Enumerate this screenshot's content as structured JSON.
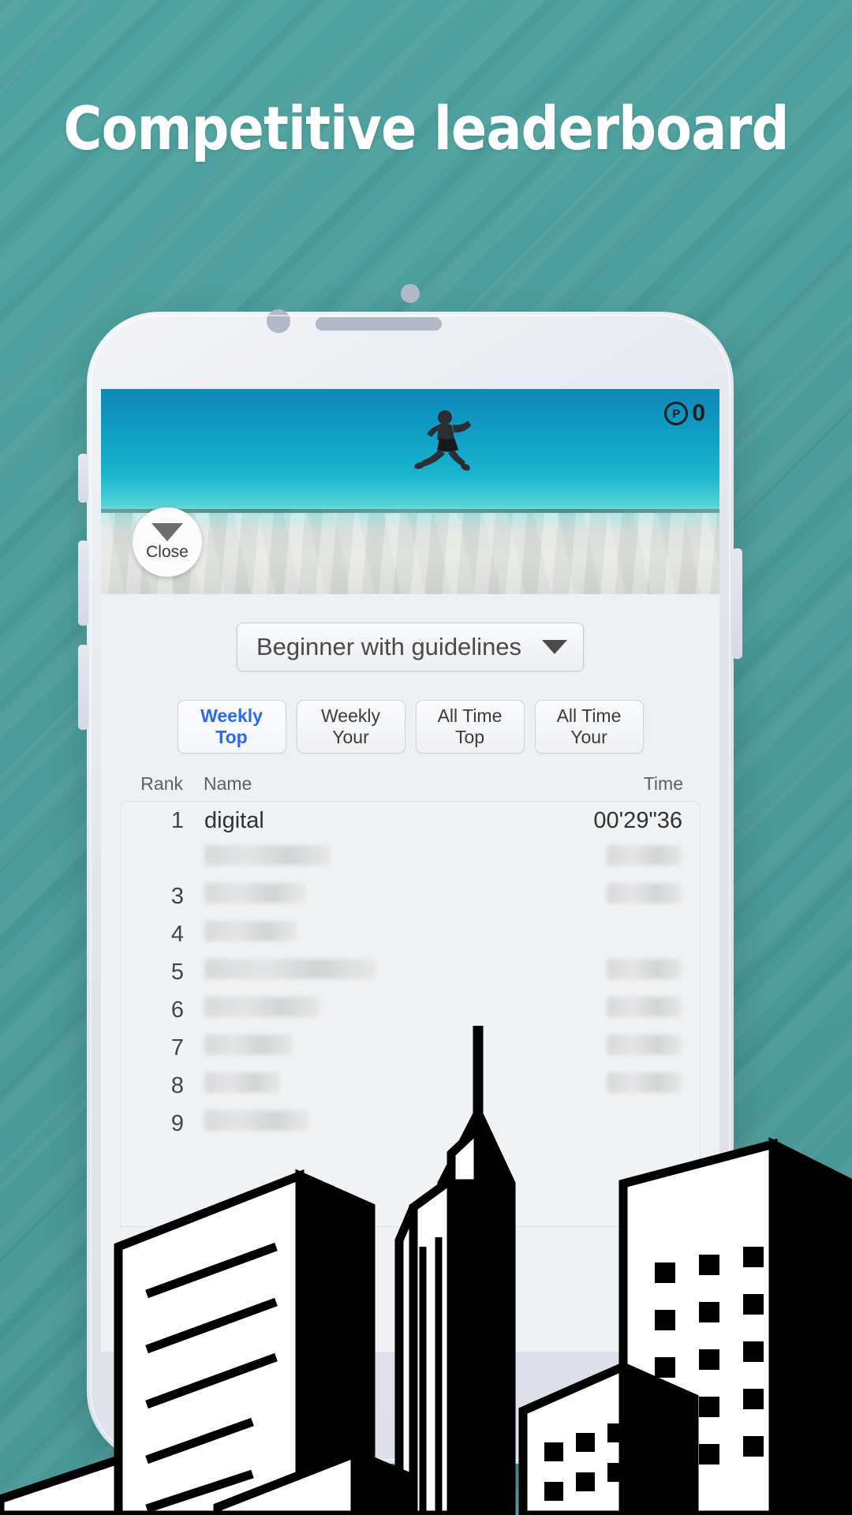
{
  "headline": "Competitive leaderboard",
  "theme": {
    "teal": "#4a9b99",
    "accent_blue": "#2a6bea",
    "screen_bg": "#eef0f2"
  },
  "phone": {
    "hardware": {
      "camera": "camera-dot",
      "sensor": "proximity-sensor-dot",
      "speaker": "earpiece-speaker",
      "mute_switch": "mute-switch",
      "volume_up": "volume-up-button",
      "volume_down": "volume-down-button",
      "power": "power-button"
    }
  },
  "hero": {
    "photo_alt": "man jumping on beach",
    "points": {
      "badge": "P",
      "value": "0"
    },
    "close_button": {
      "label": "Close",
      "icon": "triangle-down-icon"
    }
  },
  "filter": {
    "selected": "Beginner with guidelines",
    "arrow_icon": "chevron-down-icon"
  },
  "tabs": [
    {
      "line1": "Weekly",
      "line2": "Top",
      "active": true
    },
    {
      "line1": "Weekly",
      "line2": "Your",
      "active": false
    },
    {
      "line1": "All Time",
      "line2": "Top",
      "active": false
    },
    {
      "line1": "All Time",
      "line2": "Your",
      "active": false
    }
  ],
  "table": {
    "headers": {
      "rank": "Rank",
      "name": "Name",
      "time": "Time"
    },
    "rows": [
      {
        "rank": "1",
        "name": "digital",
        "time": "00'29\"36",
        "redacted": false
      },
      {
        "rank": "",
        "name": "",
        "time": "",
        "redacted": true,
        "name_w": 160,
        "time_w": 96
      },
      {
        "rank": "3",
        "name": "",
        "time": "",
        "redacted": true,
        "name_w": 128,
        "time_w": 96
      },
      {
        "rank": "4",
        "name": "",
        "time": "",
        "redacted": true,
        "name_w": 118,
        "time_w": 0
      },
      {
        "rank": "5",
        "name": "",
        "time": "",
        "redacted": true,
        "name_w": 218,
        "time_w": 96
      },
      {
        "rank": "6",
        "name": "",
        "time": "",
        "redacted": true,
        "name_w": 148,
        "time_w": 96
      },
      {
        "rank": "7",
        "name": "",
        "time": "",
        "redacted": true,
        "name_w": 112,
        "time_w": 96
      },
      {
        "rank": "8",
        "name": "",
        "time": "",
        "redacted": true,
        "name_w": 96,
        "time_w": 96
      },
      {
        "rank": "9",
        "name": "",
        "time": "",
        "redacted": true,
        "name_w": 132,
        "time_w": 0
      }
    ]
  }
}
